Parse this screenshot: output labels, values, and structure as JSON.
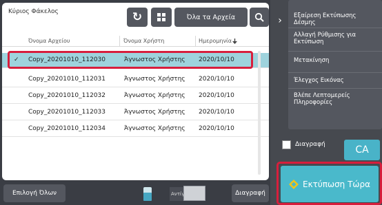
{
  "header": {
    "folder_label": "Κύριος Φάκελος",
    "filter_button": "Όλα τα Αρχεία"
  },
  "columns": [
    "Όνομα Αρχείου",
    "Όνομα Χρήστη",
    "Ημερομηνία"
  ],
  "rows": [
    {
      "file": "Copy_20201010_112030",
      "user": "Άγνωστος Χρήστης",
      "date": "2020/10/10",
      "selected": true
    },
    {
      "file": "Copy_20201010_112031",
      "user": "Άγνωστος Χρήστης",
      "date": "2020/10/10",
      "selected": false
    },
    {
      "file": "Copy_20201010_112032",
      "user": "Άγνωστος Χρήστης",
      "date": "2020/10/10",
      "selected": false
    },
    {
      "file": "Copy_20201010_112033",
      "user": "Άγνωστος Χρήστης",
      "date": "2020/10/10",
      "selected": false
    },
    {
      "file": "Copy_20201010_112034",
      "user": "Άγνωστος Χρήστης",
      "date": "2020/10/10",
      "selected": false
    }
  ],
  "bottom": {
    "select_all": "Επιλογή Όλων",
    "copies_label": "Αντίγραφα",
    "copies_value": "",
    "delete": "Διαγραφή"
  },
  "menu": {
    "items": [
      "Εξαίρεση Εκτύπωσης Δέσμης",
      "Αλλαγή Ρύθμισης για Εκτύπωση",
      "Μετακίνηση",
      "Έλεγχος Εικόνας",
      "Βλέπε Λεπτομερείς Πληροφορίες"
    ],
    "collapse_arrow": "›"
  },
  "actions": {
    "delete_checkbox_label": "Διαγραφή",
    "ca": "CA",
    "print_now": "Εκτύπωση Τώρα"
  },
  "colors": {
    "accent": "#4ab9cb",
    "selection": "#9ed3dd",
    "highlight": "#d81e3c"
  },
  "icons": [
    "refresh-icon",
    "grid-view-icon",
    "search-icon",
    "sort-desc-icon",
    "check-icon",
    "scroll-thumb-icon",
    "print-diamond-icon",
    "collapse-arrow-icon"
  ]
}
